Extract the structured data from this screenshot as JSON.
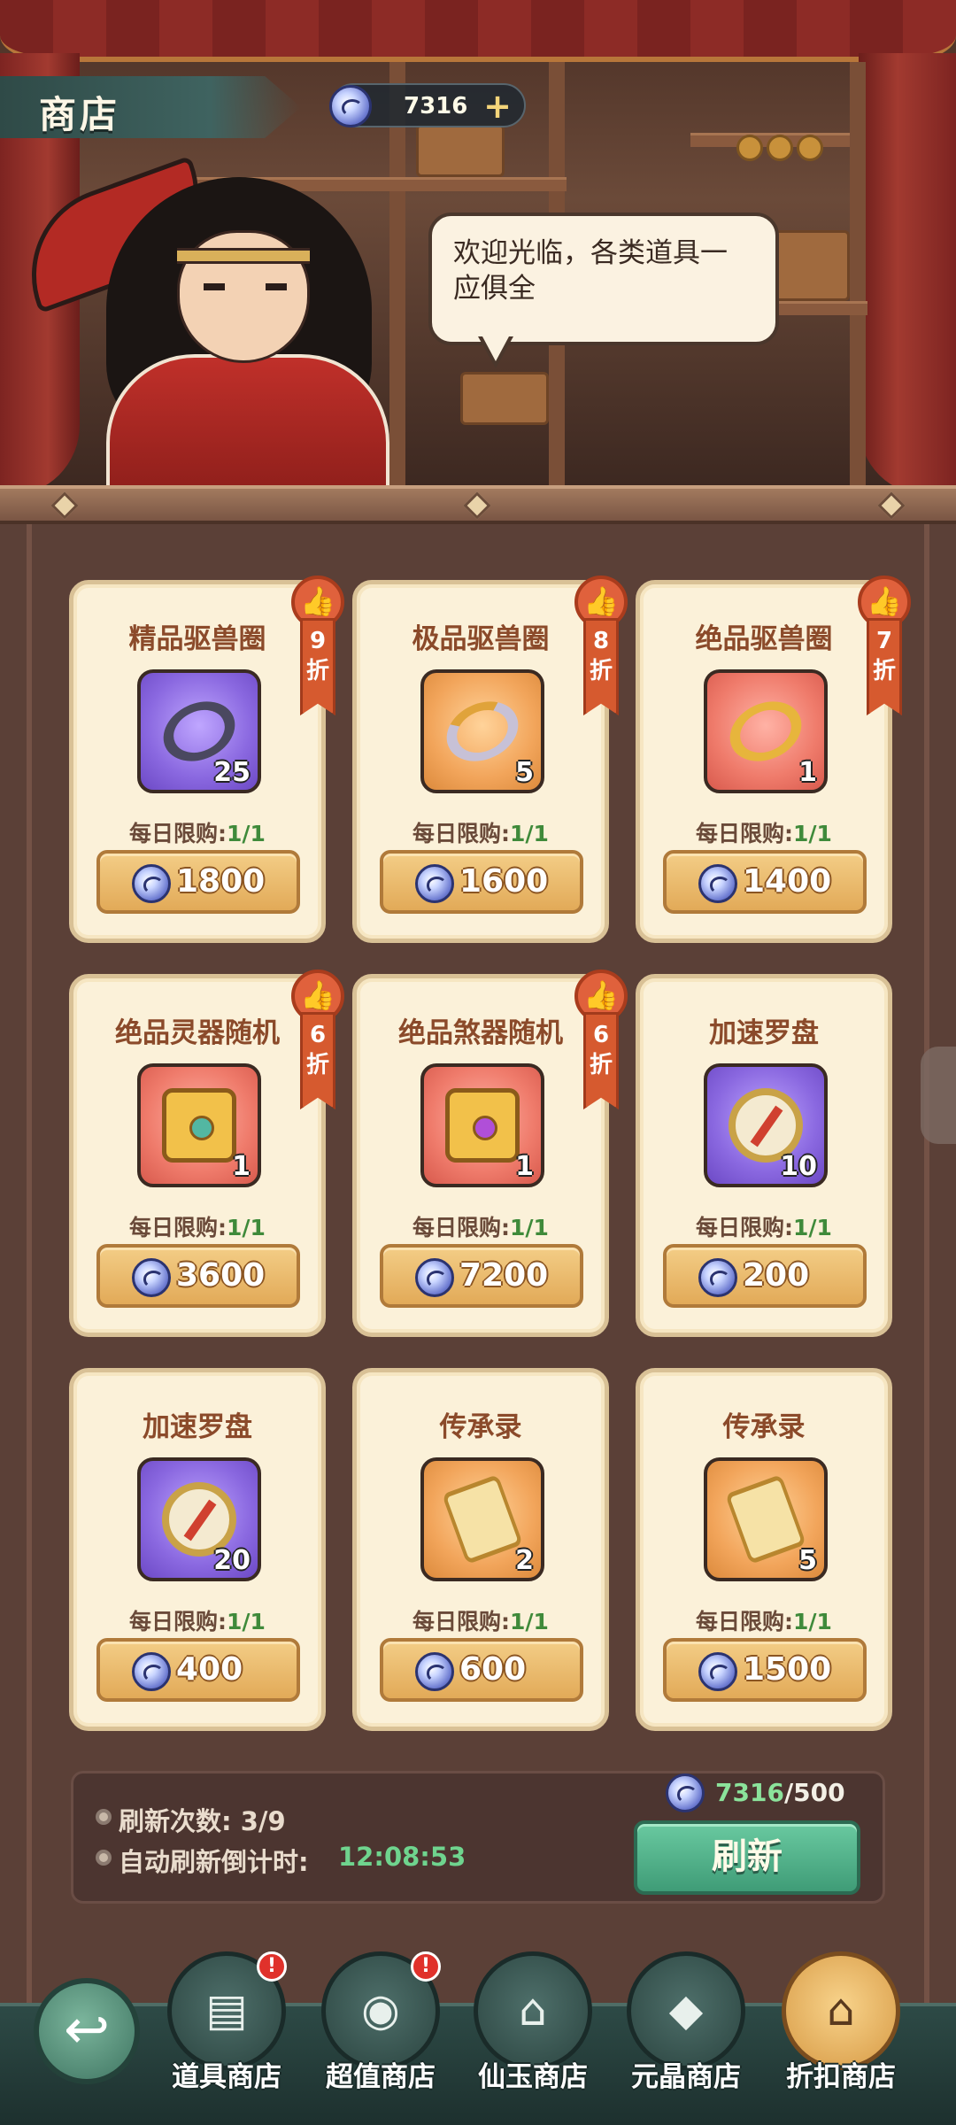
{
  "header": {
    "title": "商店",
    "currency_value": "7316",
    "add_label": "+"
  },
  "npc": {
    "speech": "欢迎光临，各类道具一应俱全"
  },
  "items": [
    {
      "name": "精品驱兽圈",
      "count": "25",
      "frame": "purple",
      "icon": "ring-icon",
      "limit_label": "每日限购:",
      "limit": "1/1",
      "price": "1800",
      "discount_num": "9",
      "discount_unit": "折"
    },
    {
      "name": "极品驱兽圈",
      "count": "5",
      "frame": "orange",
      "icon": "ring-icon",
      "limit_label": "每日限购:",
      "limit": "1/1",
      "price": "1600",
      "discount_num": "8",
      "discount_unit": "折"
    },
    {
      "name": "绝品驱兽圈",
      "count": "1",
      "frame": "red",
      "icon": "ring-icon",
      "limit_label": "每日限购:",
      "limit": "1/1",
      "price": "1400",
      "discount_num": "7",
      "discount_unit": "折"
    },
    {
      "name": "绝品灵器随机",
      "count": "1",
      "frame": "red",
      "icon": "treasure-chest-icon",
      "limit_label": "每日限购:",
      "limit": "1/1",
      "price": "3600",
      "discount_num": "6",
      "discount_unit": "折"
    },
    {
      "name": "绝品煞器随机",
      "count": "1",
      "frame": "red",
      "icon": "treasure-chest-icon",
      "limit_label": "每日限购:",
      "limit": "1/1",
      "price": "7200",
      "discount_num": "6",
      "discount_unit": "折"
    },
    {
      "name": "加速罗盘",
      "count": "10",
      "frame": "purple",
      "icon": "compass-icon",
      "limit_label": "每日限购:",
      "limit": "1/1",
      "price": "200"
    },
    {
      "name": "加速罗盘",
      "count": "20",
      "frame": "purple",
      "icon": "compass-icon",
      "limit_label": "每日限购:",
      "limit": "1/1",
      "price": "400"
    },
    {
      "name": "传承录",
      "count": "2",
      "frame": "orange",
      "icon": "scroll-icon",
      "limit_label": "每日限购:",
      "limit": "1/1",
      "price": "600"
    },
    {
      "name": "传承录",
      "count": "5",
      "frame": "orange",
      "icon": "scroll-icon",
      "limit_label": "每日限购:",
      "limit": "1/1",
      "price": "1500"
    }
  ],
  "refresh": {
    "count_label": "刷新次数: 3/9",
    "auto_label": "自动刷新倒计时:",
    "timer": "12:08:53",
    "cost_have": "7316",
    "cost_need": "/500",
    "button_label": "刷新"
  },
  "nav": {
    "tabs": [
      {
        "label": "道具商店",
        "icon": "treasure-chest-icon",
        "alert": "!"
      },
      {
        "label": "超值商店",
        "icon": "money-bag-icon",
        "alert": "!"
      },
      {
        "label": "仙玉商店",
        "icon": "pavilion-icon"
      },
      {
        "label": "元晶商店",
        "icon": "crystal-icon"
      },
      {
        "label": "折扣商店",
        "icon": "shop-icon",
        "active": true
      }
    ]
  },
  "colors": {
    "accent_green": "#3f9c77",
    "price_gold": "#e2aa58",
    "card_bg": "#fbf1d9",
    "timer_green": "#6fd48e"
  }
}
